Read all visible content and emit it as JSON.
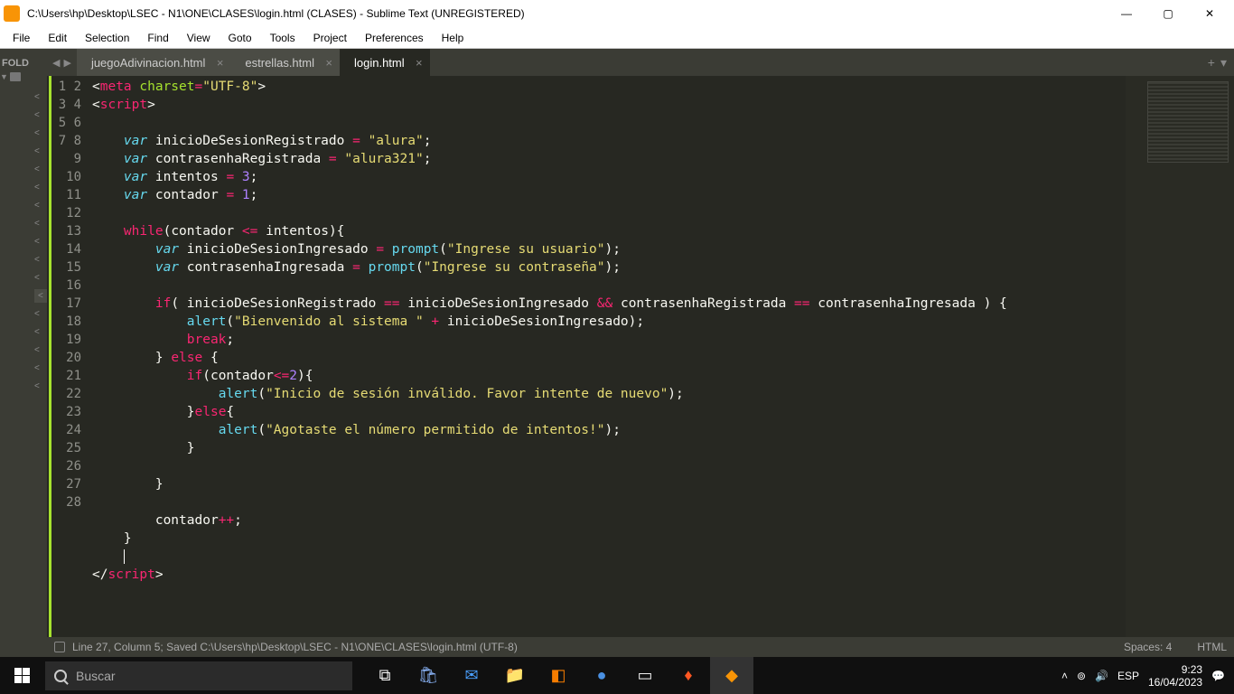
{
  "window": {
    "title": "C:\\Users\\hp\\Desktop\\LSEC - N1\\ONE\\CLASES\\login.html (CLASES) - Sublime Text (UNREGISTERED)"
  },
  "menu": {
    "file": "File",
    "edit": "Edit",
    "selection": "Selection",
    "find": "Find",
    "view": "View",
    "goto": "Goto",
    "tools": "Tools",
    "project": "Project",
    "preferences": "Preferences",
    "help": "Help"
  },
  "sidebar": {
    "label": "FOLD"
  },
  "tabs": [
    {
      "label": "juegoAdivinacion.html",
      "active": false
    },
    {
      "label": "estrellas.html",
      "active": false
    },
    {
      "label": "login.html",
      "active": true
    }
  ],
  "code": {
    "line1_meta": "meta",
    "line1_charset_attr": "charset",
    "line1_charset_val": "\"UTF-8\"",
    "line2_script": "script",
    "var": "var",
    "while": "while",
    "if": "if",
    "else": "else",
    "break": "break",
    "prompt": "prompt",
    "alert": "alert",
    "id_inicioReg": "inicioDeSesionRegistrado",
    "val_alura": "\"alura\"",
    "id_contraReg": "contrasenhaRegistrada",
    "val_alura321": "\"alura321\"",
    "id_intentos": "intentos",
    "num3": "3",
    "id_contador": "contador",
    "num1": "1",
    "id_inicioIng": "inicioDeSesionIngresado",
    "str_ingrese_user": "\"Ingrese su usuario\"",
    "id_contraIng": "contrasenhaIngresada",
    "str_ingrese_pass": "\"Ingrese su contraseña\"",
    "str_bienvenido": "\"Bienvenido al sistema \"",
    "num2": "2",
    "str_invalido": "\"Inicio de sesión inválido. Favor intente de nuevo\"",
    "str_agotaste": "\"Agotaste el número permitido de intentos!\"",
    "op_and": "&&",
    "op_eq": "==",
    "op_le": "<=",
    "op_assign": "=",
    "op_plus": "+",
    "op_inc": "++"
  },
  "lines": [
    "1",
    "2",
    "3",
    "4",
    "5",
    "6",
    "7",
    "8",
    "9",
    "10",
    "11",
    "12",
    "13",
    "14",
    "15",
    "16",
    "17",
    "18",
    "19",
    "20",
    "21",
    "22",
    "23",
    "24",
    "25",
    "26",
    "27",
    "28"
  ],
  "status": {
    "text": "Line 27, Column 5; Saved C:\\Users\\hp\\Desktop\\LSEC - N1\\ONE\\CLASES\\login.html (UTF-8)",
    "spaces": "Spaces: 4",
    "lang": "HTML"
  },
  "taskbar": {
    "search_placeholder": "Buscar",
    "lang": "ESP",
    "time": "9:23",
    "date": "16/04/2023"
  }
}
